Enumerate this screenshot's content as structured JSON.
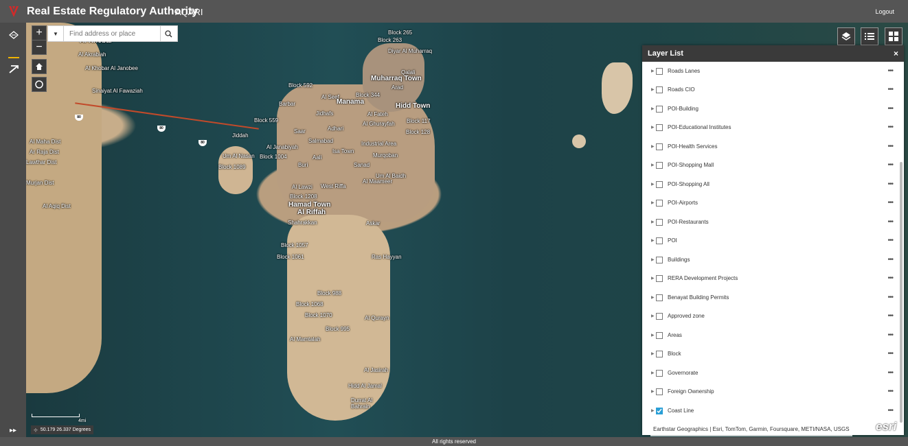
{
  "app": {
    "title": "Real Estate Regulatory Authority",
    "subtitle": "AQARI",
    "logout": "Logout",
    "footer": "All rights reserved"
  },
  "search": {
    "placeholder": "Find address or place"
  },
  "map_controls": {
    "zoom_in": "+",
    "zoom_out": "−"
  },
  "map_labels": [
    "Al Khobar",
    "Al Akrabiah",
    "Al Khobar Al Janobee",
    "Sinaiyat Al Fawaziah",
    "Block 265",
    "Block 263",
    "Diyar Al Muharraq",
    "Qalali",
    "Muharraq Town",
    "Arad",
    "Block 592",
    "Al Seef",
    "Block 344",
    "Hidd Town",
    "Barbar",
    "Manama",
    "Jidhafs",
    "Al Fateh",
    "Block 559",
    "Al Ghurayfah",
    "Block 117",
    "Saar",
    "Adhari",
    "Block 128",
    "Jiddah",
    "Salmabad",
    "Industrial Area",
    "Al Janabiyah",
    "Isa Town",
    "Um Al Nasan",
    "Block 1004",
    "Aali",
    "Murqoban",
    "Block 1089",
    "Buri",
    "Sanad",
    "Um Al Baidh",
    "Al Maameer",
    "Al Lawzi",
    "West Riffa",
    "Block 1208",
    "Hamad Town",
    "Al Riffah",
    "Shahrakkan",
    "Askar",
    "Block 1057",
    "Block 1061",
    "Ras Hayyan",
    "Block 988",
    "Block 1068",
    "Block 1070",
    "Al Qurayn",
    "Block 995",
    "Al Mamtalah",
    "Al Jasirah",
    "Hidd Al Jamal",
    "Durrat Al Bahrain",
    "Al Maha Dist",
    "Ar Raja Dist",
    "Lawthar Dist",
    "Murjan Dist",
    "Al Aqiq Dist"
  ],
  "road_shields": [
    "80",
    "80",
    "80"
  ],
  "layer_list": {
    "title": "Layer List",
    "close": "×",
    "layers": [
      {
        "name": "Roads Lanes",
        "checked": false
      },
      {
        "name": "Roads CIO",
        "checked": false
      },
      {
        "name": "POI-Building",
        "checked": false
      },
      {
        "name": "POI-Educational Institutes",
        "checked": false
      },
      {
        "name": "POI-Health Services",
        "checked": false
      },
      {
        "name": "POI-Shopping Mall",
        "checked": false
      },
      {
        "name": "POI-Shopping All",
        "checked": false
      },
      {
        "name": "POI-Airports",
        "checked": false
      },
      {
        "name": "POI-Restaurants",
        "checked": false
      },
      {
        "name": "POI",
        "checked": false
      },
      {
        "name": "Buildings",
        "checked": false
      },
      {
        "name": "RERA Development Projects",
        "checked": false
      },
      {
        "name": "Benayat Building Permits",
        "checked": false
      },
      {
        "name": "Approved zone",
        "checked": false
      },
      {
        "name": "Areas",
        "checked": false
      },
      {
        "name": "Block",
        "checked": false
      },
      {
        "name": "Governorate",
        "checked": false
      },
      {
        "name": "Foreign Ownership",
        "checked": false
      },
      {
        "name": "Coast Line",
        "checked": true
      }
    ],
    "more_glyph": "•••"
  },
  "scale": {
    "label": "4mi"
  },
  "coordinates": "50.179 26.337 Degrees",
  "attribution": "Earthstar Geographics | Esri, TomTom, Garmin, Foursquare, METI/NASA, USGS",
  "esri_logo": "esri",
  "colors": {
    "header": "#555555",
    "sidebar": "#4a4a4a",
    "checkbox_checked": "#2a9fd6",
    "active_tool": "#f0b400"
  }
}
